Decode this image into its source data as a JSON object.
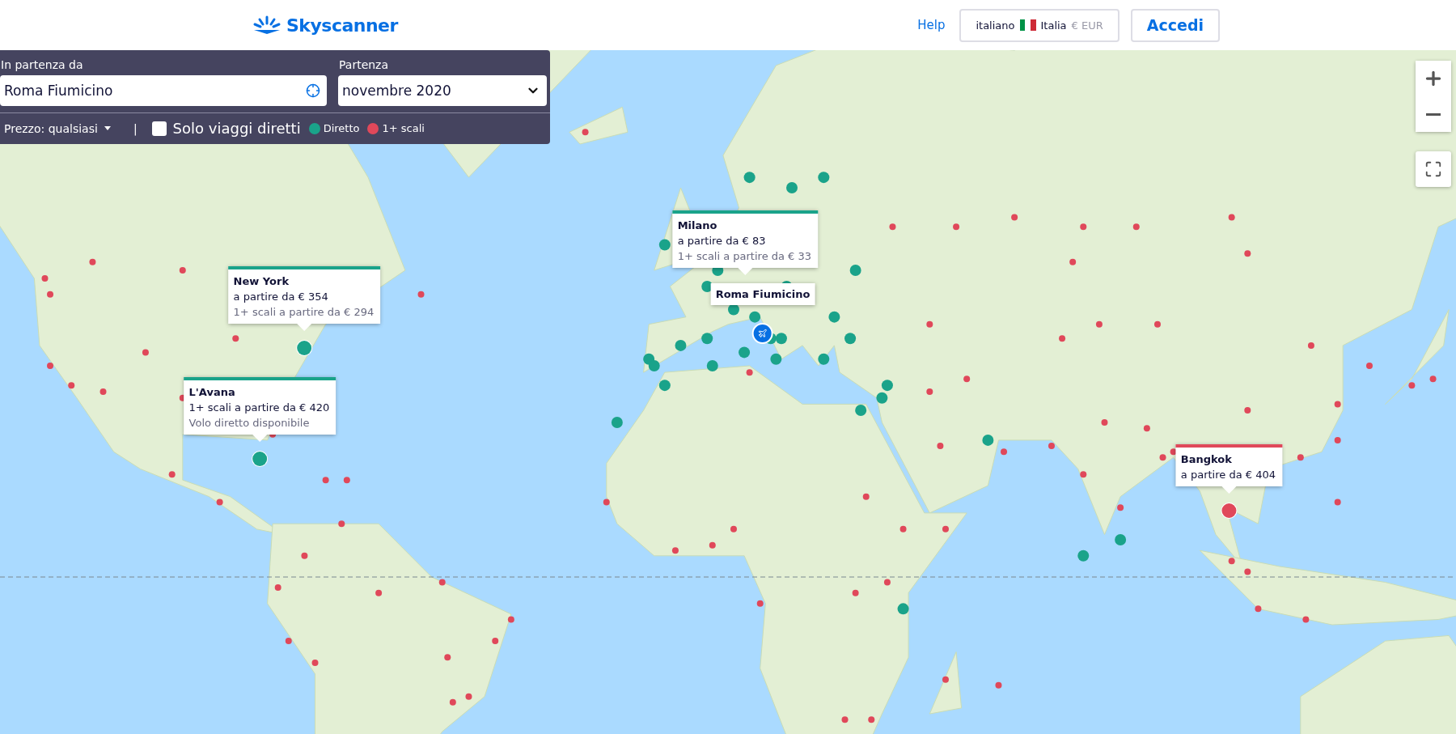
{
  "header": {
    "logo": "Skyscanner",
    "help": "Help",
    "locale": {
      "language": "italiano",
      "country": "Italia",
      "currency": "€ EUR"
    },
    "login": "Accedi"
  },
  "search_panel": {
    "origin": {
      "label": "In partenza da",
      "value": "Roma Fiumicino"
    },
    "departure": {
      "label": "Partenza",
      "value": "novembre 2020"
    },
    "price_filter": "Prezzo: qualsiasi",
    "separator": "|",
    "direct_only": {
      "label": "Solo viaggi diretti",
      "checked": false
    },
    "legend": [
      {
        "label": "Diretto",
        "color": "#1aa38a"
      },
      {
        "label": "1+ scali",
        "color": "#e0485a"
      }
    ]
  },
  "map": {
    "origin_label": "Roma Fiumicino",
    "destinations": [
      {
        "name": "New York",
        "kind": "direct",
        "lines": [
          {
            "text": "a partire da € 354",
            "secondary": false
          },
          {
            "text": "1+ scali a partire da € 294",
            "secondary": true
          }
        ]
      },
      {
        "name": "L'Avana",
        "kind": "direct",
        "lines": [
          {
            "text": "1+ scali a partire da € 420",
            "secondary": false
          },
          {
            "text": "Volo diretto disponibile",
            "secondary": true
          }
        ]
      },
      {
        "name": "Milano",
        "kind": "direct",
        "lines": [
          {
            "text": "a partire da € 83",
            "secondary": false
          },
          {
            "text": "1+ scali a partire da € 33",
            "secondary": true
          }
        ]
      },
      {
        "name": "Bangkok",
        "kind": "stops",
        "lines": [
          {
            "text": "a partire da € 404",
            "secondary": false
          }
        ]
      }
    ]
  }
}
